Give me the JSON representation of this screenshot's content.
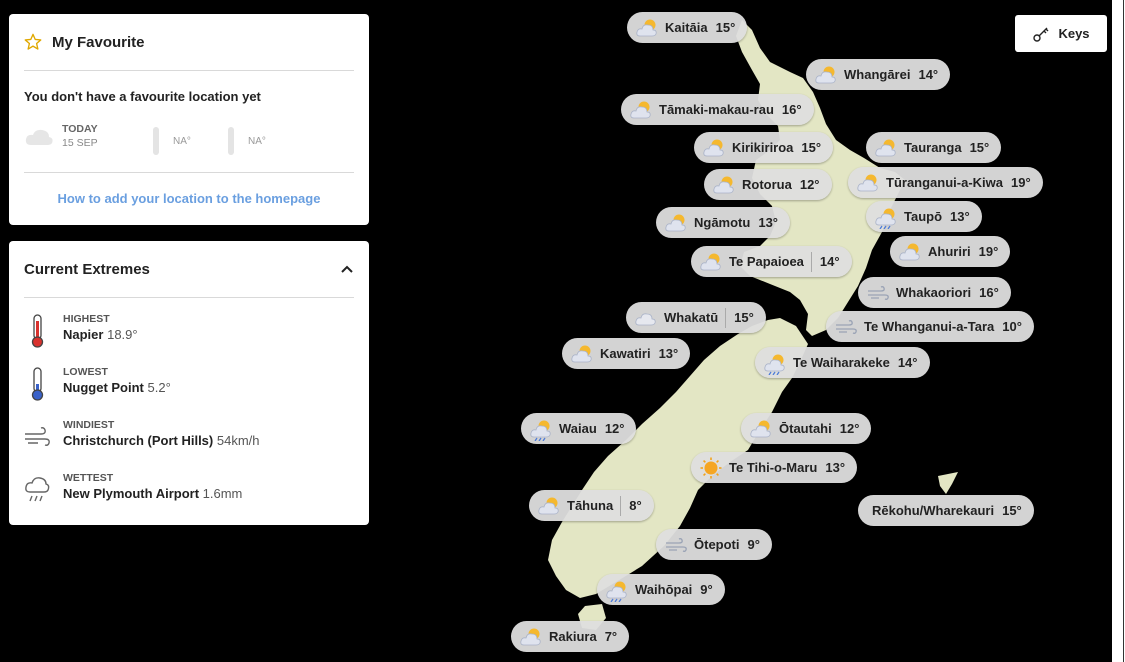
{
  "favourite": {
    "title": "My Favourite",
    "message": "You don't have a favourite location yet",
    "today_label": "TODAY",
    "date": "15 SEP",
    "high": "NA°",
    "low": "NA°",
    "link": "How to add your location to the homepage"
  },
  "extremes": {
    "title": "Current Extremes",
    "items": [
      {
        "label": "HIGHEST",
        "place": "Napier",
        "value": "18.9°",
        "icon": "thermometer-hot-icon"
      },
      {
        "label": "LOWEST",
        "place": "Nugget Point",
        "value": "5.2°",
        "icon": "thermometer-cold-icon"
      },
      {
        "label": "WINDIEST",
        "place": "Christchurch (Port Hills)",
        "value": "54km/h",
        "icon": "wind-icon"
      },
      {
        "label": "WETTEST",
        "place": "New Plymouth Airport",
        "value": "1.6mm",
        "icon": "rain-cloud-icon"
      }
    ]
  },
  "keys_label": "Keys",
  "locations": [
    {
      "name": "Kaitāia",
      "temp": "15°",
      "icon": "partly-cloudy-icon"
    },
    {
      "name": "Whangārei",
      "temp": "14°",
      "icon": "partly-cloudy-icon"
    },
    {
      "name": "Tāmaki-makau-rau",
      "temp": "16°",
      "icon": "partly-cloudy-icon"
    },
    {
      "name": "Kirikiriroa",
      "temp": "15°",
      "icon": "partly-cloudy-icon"
    },
    {
      "name": "Tauranga",
      "temp": "15°",
      "icon": "partly-cloudy-icon"
    },
    {
      "name": "Rotorua",
      "temp": "12°",
      "icon": "partly-cloudy-icon"
    },
    {
      "name": "Tūranganui-a-Kiwa",
      "temp": "19°",
      "icon": "partly-cloudy-icon"
    },
    {
      "name": "Taupō",
      "temp": "13°",
      "icon": "showers-icon"
    },
    {
      "name": "Ngāmotu",
      "temp": "13°",
      "icon": "partly-cloudy-icon"
    },
    {
      "name": "Ahuriri",
      "temp": "19°",
      "icon": "partly-cloudy-icon"
    },
    {
      "name": "Te Papaioea",
      "temp": "14°",
      "icon": "partly-cloudy-icon"
    },
    {
      "name": "Whakaoriori",
      "temp": "16°",
      "icon": "wind-icon"
    },
    {
      "name": "Whakatū",
      "temp": "15°",
      "icon": "cloudy-icon"
    },
    {
      "name": "Te Whanganui-a-Tara",
      "temp": "10°",
      "icon": "wind-icon"
    },
    {
      "name": "Kawatiri",
      "temp": "13°",
      "icon": "partly-cloudy-icon"
    },
    {
      "name": "Te Waiharakeke",
      "temp": "14°",
      "icon": "showers-icon"
    },
    {
      "name": "Waiau",
      "temp": "12°",
      "icon": "showers-icon"
    },
    {
      "name": "Ōtautahi",
      "temp": "12°",
      "icon": "partly-cloudy-icon"
    },
    {
      "name": "Te Tihi-o-Maru",
      "temp": "13°",
      "icon": "sunny-icon"
    },
    {
      "name": "Rēkohu/Wharekauri",
      "temp": "15°",
      "icon": ""
    },
    {
      "name": "Tāhuna",
      "temp": "8°",
      "icon": "partly-cloudy-icon"
    },
    {
      "name": "Ōtepoti",
      "temp": "9°",
      "icon": "wind-icon"
    },
    {
      "name": "Waihōpai",
      "temp": "9°",
      "icon": "showers-icon"
    },
    {
      "name": "Rakiura",
      "temp": "7°",
      "icon": "partly-cloudy-icon"
    }
  ]
}
